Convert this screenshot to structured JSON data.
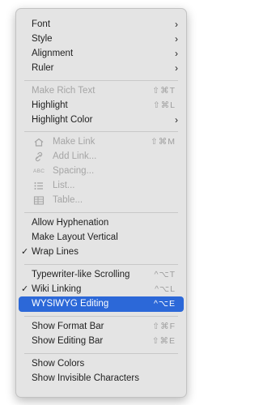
{
  "menu": {
    "font": {
      "label": "Font",
      "submenu": "›"
    },
    "style": {
      "label": "Style",
      "submenu": "›"
    },
    "alignment": {
      "label": "Alignment",
      "submenu": "›"
    },
    "ruler": {
      "label": "Ruler",
      "submenu": "›"
    },
    "make_rich_text": {
      "label": "Make Rich Text",
      "shortcut": "⇧⌘T",
      "enabled": false
    },
    "highlight": {
      "label": "Highlight",
      "shortcut": "⇧⌘L"
    },
    "highlight_color": {
      "label": "Highlight Color",
      "submenu": "›"
    },
    "make_link": {
      "label": "Make Link",
      "shortcut": "⇧⌘M",
      "enabled": false,
      "icon": "link-icon"
    },
    "add_link": {
      "label": "Add Link...",
      "enabled": false,
      "icon": "paperclip-link-icon"
    },
    "spacing": {
      "label": "Spacing...",
      "enabled": false,
      "icon": "abc-spacing-icon",
      "icon_text": "ABC"
    },
    "list": {
      "label": "List...",
      "enabled": false,
      "icon": "list-icon"
    },
    "table": {
      "label": "Table...",
      "enabled": false,
      "icon": "table-icon"
    },
    "allow_hyphenation": {
      "label": "Allow Hyphenation"
    },
    "make_layout_vertical": {
      "label": "Make Layout Vertical"
    },
    "wrap_lines": {
      "label": "Wrap Lines",
      "checked": true,
      "check": "✓"
    },
    "typewriter_scrolling": {
      "label": "Typewriter-like Scrolling",
      "shortcut": "^⌥T"
    },
    "wiki_linking": {
      "label": "Wiki Linking",
      "shortcut": "^⌥L",
      "checked": true,
      "check": "✓"
    },
    "wysiwyg_editing": {
      "label": "WYSIWYG Editing",
      "shortcut": "^⌥E",
      "selected": true
    },
    "show_format_bar": {
      "label": "Show Format Bar",
      "shortcut": "⇧⌘F"
    },
    "show_editing_bar": {
      "label": "Show Editing Bar",
      "shortcut": "⇧⌘E"
    },
    "show_colors": {
      "label": "Show Colors"
    },
    "show_invisible_characters": {
      "label": "Show Invisible Characters"
    }
  },
  "colors": {
    "menu_background": "#e4e4e4",
    "selection": "#2c68d8",
    "disabled_text": "#a5a5a5",
    "shortcut_text": "#9e9e9e"
  }
}
